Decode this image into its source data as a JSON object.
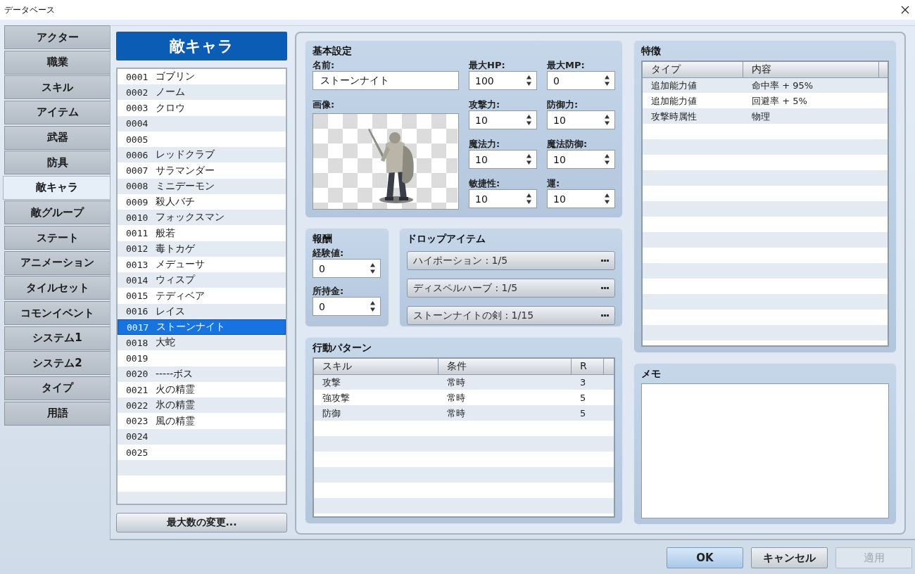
{
  "window": {
    "title": "データベース"
  },
  "tabs": [
    {
      "label": "アクター",
      "selected": false
    },
    {
      "label": "職業",
      "selected": false
    },
    {
      "label": "スキル",
      "selected": false
    },
    {
      "label": "アイテム",
      "selected": false
    },
    {
      "label": "武器",
      "selected": false
    },
    {
      "label": "防具",
      "selected": false
    },
    {
      "label": "敵キャラ",
      "selected": true
    },
    {
      "label": "敵グループ",
      "selected": false
    },
    {
      "label": "ステート",
      "selected": false
    },
    {
      "label": "アニメーション",
      "selected": false
    },
    {
      "label": "タイルセット",
      "selected": false
    },
    {
      "label": "コモンイベント",
      "selected": false
    },
    {
      "label": "システム1",
      "selected": false
    },
    {
      "label": "システム2",
      "selected": false
    },
    {
      "label": "タイプ",
      "selected": false
    },
    {
      "label": "用語",
      "selected": false
    }
  ],
  "list": {
    "title": "敵キャラ",
    "items": [
      {
        "id": "0001",
        "name": "ゴブリン",
        "selected": false
      },
      {
        "id": "0002",
        "name": "ノーム",
        "selected": false
      },
      {
        "id": "0003",
        "name": "クロウ",
        "selected": false
      },
      {
        "id": "0004",
        "selected": false
      },
      {
        "id": "0005",
        "selected": false
      },
      {
        "id": "0006",
        "name": "レッドクラブ",
        "selected": false
      },
      {
        "id": "0007",
        "name": "サラマンダー",
        "selected": false
      },
      {
        "id": "0008",
        "name": "ミニデーモン",
        "selected": false
      },
      {
        "id": "0009",
        "name": "殺人バチ",
        "selected": false
      },
      {
        "id": "0010",
        "name": "フォックスマン",
        "selected": false
      },
      {
        "id": "0011",
        "name": "般若",
        "selected": false
      },
      {
        "id": "0012",
        "name": "毒トカゲ",
        "selected": false
      },
      {
        "id": "0013",
        "name": "メデューサ",
        "selected": false
      },
      {
        "id": "0014",
        "name": "ウィスプ",
        "selected": false
      },
      {
        "id": "0015",
        "name": "テディベア",
        "selected": false
      },
      {
        "id": "0016",
        "name": "レイス",
        "selected": false
      },
      {
        "id": "0017",
        "name": "ストーンナイト",
        "selected": true
      },
      {
        "id": "0018",
        "name": "大蛇",
        "selected": false
      },
      {
        "id": "0019",
        "selected": false
      },
      {
        "id": "0020",
        "name": "-----ボス",
        "selected": false
      },
      {
        "id": "0021",
        "name": "火の精霊",
        "selected": false
      },
      {
        "id": "0022",
        "name": "氷の精霊",
        "selected": false
      },
      {
        "id": "0023",
        "name": "風の精霊",
        "selected": false
      },
      {
        "id": "0024",
        "selected": false
      },
      {
        "id": "0025",
        "selected": false
      }
    ],
    "button": "最大数の変更..."
  },
  "basic": {
    "title": "基本設定",
    "name_label": "名前:",
    "name_value": "ストーンナイト",
    "image_label": "画像:",
    "params": [
      {
        "label": "最大HP:",
        "value": "100"
      },
      {
        "label": "最大MP:",
        "value": "0"
      },
      {
        "label": "攻撃力:",
        "value": "10"
      },
      {
        "label": "防御力:",
        "value": "10"
      },
      {
        "label": "魔法力:",
        "value": "10"
      },
      {
        "label": "魔法防御:",
        "value": "10"
      },
      {
        "label": "敏捷性:",
        "value": "10"
      },
      {
        "label": "運:",
        "value": "10"
      }
    ]
  },
  "reward": {
    "title": "報酬",
    "fields": [
      {
        "label": "経験値:",
        "value": "0"
      },
      {
        "label": "所持金:",
        "value": "0"
      }
    ]
  },
  "drops": {
    "title": "ドロップアイテム",
    "items": [
      "ハイポーション : 1/5",
      "ディスペルハーブ : 1/5",
      "ストーンナイトの剣 : 1/15"
    ]
  },
  "actions": {
    "title": "行動パターン",
    "columns": [
      "スキル",
      "条件",
      "R"
    ],
    "rows": [
      [
        "攻撃",
        "常時",
        "3"
      ],
      [
        "強攻撃",
        "常時",
        "5"
      ],
      [
        "防御",
        "常時",
        "5"
      ]
    ]
  },
  "traits": {
    "title": "特徴",
    "columns": [
      "タイプ",
      "内容"
    ],
    "rows": [
      [
        "追加能力値",
        "命中率 + 95%"
      ],
      [
        "追加能力値",
        "回避率 + 5%"
      ],
      [
        "攻撃時属性",
        "物理"
      ]
    ]
  },
  "memo": {
    "title": "メモ"
  },
  "buttons": [
    {
      "label": "OK",
      "default": true,
      "disabled": false
    },
    {
      "label": "キャンセル",
      "default": false,
      "disabled": false
    },
    {
      "label": "適用",
      "default": false,
      "disabled": true
    }
  ]
}
